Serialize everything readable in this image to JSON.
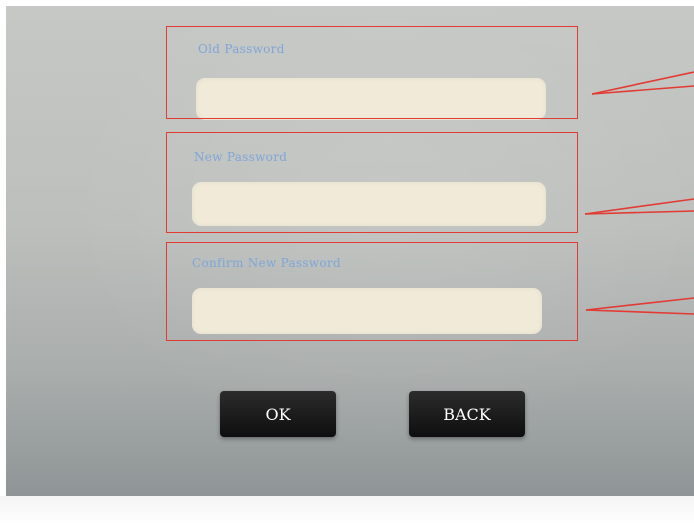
{
  "form": {
    "old_password": {
      "label": "Old Password",
      "value": "",
      "placeholder": ""
    },
    "new_password": {
      "label": "New Password",
      "value": "",
      "placeholder": ""
    },
    "confirm_password": {
      "label": "Confirm New Password",
      "value": "",
      "placeholder": ""
    }
  },
  "buttons": {
    "ok_label": "OK",
    "back_label": "BACK"
  },
  "colors": {
    "label_text": "#7fa6d8",
    "input_fill": "#f1ead9",
    "annotation": "#e33a33",
    "button_fill": "#111111",
    "button_text": "#ffffff"
  }
}
